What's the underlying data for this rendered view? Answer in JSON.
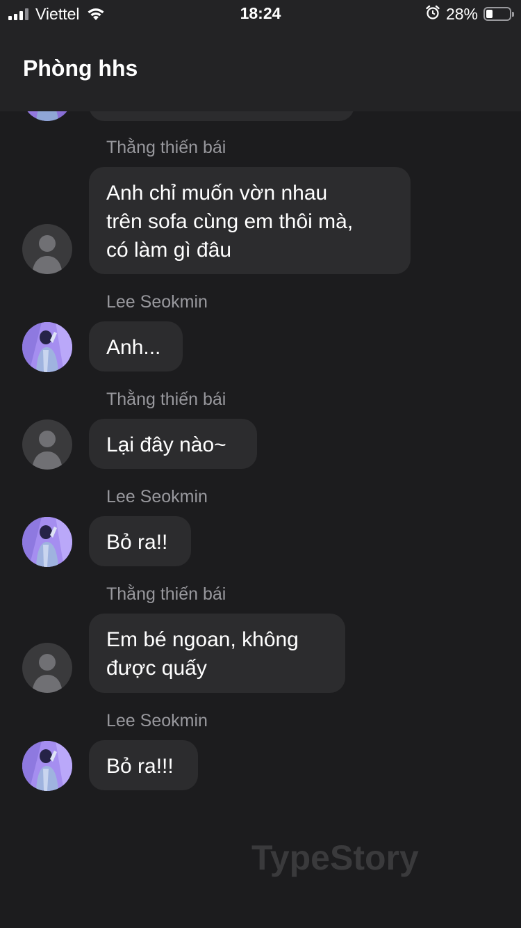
{
  "status_bar": {
    "carrier": "Viettel",
    "time": "18:24",
    "battery_percent": "28%",
    "battery_level": 0.28,
    "icons": [
      "signal-icon",
      "wifi-icon",
      "alarm-icon",
      "battery-icon"
    ]
  },
  "header": {
    "title": "Phòng hhs"
  },
  "messages": [
    {
      "sender": "Thằng thiến bái",
      "text": "Anh chỉ muốn vờn nhau\ntrên sofa cùng em thôi mà,\ncó làm gì đâu",
      "avatar": "default-avatar"
    },
    {
      "sender": "Lee Seokmin",
      "text": "Anh...",
      "avatar": "photo-avatar"
    },
    {
      "sender": "Thằng thiến bái",
      "text": "Lại đây nào~",
      "avatar": "default-avatar"
    },
    {
      "sender": "Lee Seokmin",
      "text": "Bỏ ra!!",
      "avatar": "photo-avatar"
    },
    {
      "sender": "Thằng thiến bái",
      "text": "Em bé ngoan, không\nđược quấy",
      "avatar": "default-avatar"
    },
    {
      "sender": "Lee Seokmin",
      "text": "Bỏ ra!!!",
      "avatar": "photo-avatar"
    }
  ],
  "watermark": "TypeStory",
  "colors": {
    "background": "#1c1c1e",
    "header_background": "#232325",
    "bubble": "#2c2c2e",
    "sender_name": "#98989d",
    "default_avatar": "#3a3a3c",
    "watermark": "#3a3a3c"
  }
}
